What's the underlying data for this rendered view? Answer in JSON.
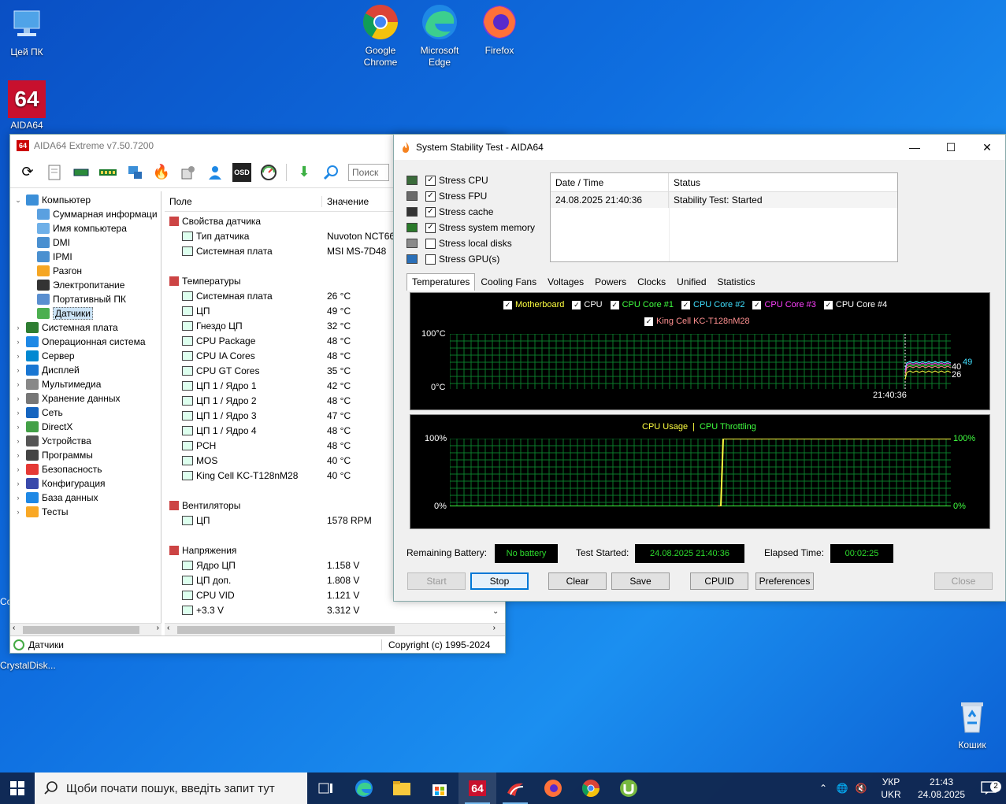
{
  "desktop": {
    "icons": [
      {
        "label": "Цей ПК"
      },
      {
        "label": "Google Chrome"
      },
      {
        "label": "Microsoft Edge"
      },
      {
        "label": "Firefox"
      },
      {
        "label": "AIDA64"
      },
      {
        "label": "CrystalDisk..."
      },
      {
        "label": "Кошик"
      }
    ],
    "partial_label_left": "Co"
  },
  "aida": {
    "title": "AIDA64 Extreme v7.50.7200",
    "app_badge": "64",
    "search_placeholder": "Поиск",
    "osd_label": "OSD",
    "tree": [
      {
        "label": "Компьютер",
        "expanded": true
      },
      {
        "label": "Суммарная информаци",
        "child": true
      },
      {
        "label": "Имя компьютера",
        "child": true
      },
      {
        "label": "DMI",
        "child": true
      },
      {
        "label": "IPMI",
        "child": true
      },
      {
        "label": "Разгон",
        "child": true
      },
      {
        "label": "Электропитание",
        "child": true
      },
      {
        "label": "Портативный ПК",
        "child": true
      },
      {
        "label": "Датчики",
        "child": true,
        "selected": true
      },
      {
        "label": "Системная плата"
      },
      {
        "label": "Операционная система"
      },
      {
        "label": "Сервер"
      },
      {
        "label": "Дисплей"
      },
      {
        "label": "Мультимедиа"
      },
      {
        "label": "Хранение данных"
      },
      {
        "label": "Сеть"
      },
      {
        "label": "DirectX"
      },
      {
        "label": "Устройства"
      },
      {
        "label": "Программы"
      },
      {
        "label": "Безопасность"
      },
      {
        "label": "Конфигурация"
      },
      {
        "label": "База данных"
      },
      {
        "label": "Тесты"
      }
    ],
    "columns": {
      "field": "Поле",
      "value": "Значение"
    },
    "rows": [
      {
        "type": "sec",
        "name": "Свойства датчика",
        "value": ""
      },
      {
        "type": "item",
        "name": "Тип датчика",
        "value": "Nuvoton NCT66"
      },
      {
        "type": "item",
        "name": "Системная плата",
        "value": "MSI MS-7D48"
      },
      {
        "type": "gap"
      },
      {
        "type": "sec",
        "name": "Температуры",
        "value": ""
      },
      {
        "type": "item",
        "name": "Системная плата",
        "value": "26 °C"
      },
      {
        "type": "item",
        "name": "ЦП",
        "value": "49 °C"
      },
      {
        "type": "item",
        "name": "Гнездо ЦП",
        "value": "32 °C"
      },
      {
        "type": "item",
        "name": "CPU Package",
        "value": "48 °C"
      },
      {
        "type": "item",
        "name": "CPU IA Cores",
        "value": "48 °C"
      },
      {
        "type": "item",
        "name": "CPU GT Cores",
        "value": "35 °C"
      },
      {
        "type": "item",
        "name": "ЦП 1 / Ядро 1",
        "value": "42 °C"
      },
      {
        "type": "item",
        "name": "ЦП 1 / Ядро 2",
        "value": "48 °C"
      },
      {
        "type": "item",
        "name": "ЦП 1 / Ядро 3",
        "value": "47 °C"
      },
      {
        "type": "item",
        "name": "ЦП 1 / Ядро 4",
        "value": "48 °C"
      },
      {
        "type": "item",
        "name": "PCH",
        "value": "48 °C"
      },
      {
        "type": "item",
        "name": "MOS",
        "value": "40 °C"
      },
      {
        "type": "item",
        "name": "King Cell KC-T128nM28",
        "value": "40 °C"
      },
      {
        "type": "gap"
      },
      {
        "type": "sec",
        "name": "Вентиляторы",
        "value": ""
      },
      {
        "type": "item",
        "name": "ЦП",
        "value": "1578 RPM"
      },
      {
        "type": "gap"
      },
      {
        "type": "sec",
        "name": "Напряжения",
        "value": ""
      },
      {
        "type": "item",
        "name": "Ядро ЦП",
        "value": "1.158 V"
      },
      {
        "type": "item",
        "name": "ЦП доп.",
        "value": "1.808 V"
      },
      {
        "type": "item",
        "name": "CPU VID",
        "value": "1.121 V"
      },
      {
        "type": "item",
        "name": "+3.3 V",
        "value": "3.312 V"
      }
    ],
    "status_left": "Датчики",
    "status_right": "Copyright (c) 1995-2024"
  },
  "sst": {
    "title": "System Stability Test - AIDA64",
    "stress": [
      {
        "label": "Stress CPU",
        "checked": true
      },
      {
        "label": "Stress FPU",
        "checked": true
      },
      {
        "label": "Stress cache",
        "checked": true
      },
      {
        "label": "Stress system memory",
        "checked": true
      },
      {
        "label": "Stress local disks",
        "checked": false
      },
      {
        "label": "Stress GPU(s)",
        "checked": false
      }
    ],
    "log": {
      "col_date": "Date / Time",
      "col_status": "Status",
      "rows": [
        {
          "date": "24.08.2025 21:40:36",
          "status": "Stability Test: Started"
        }
      ]
    },
    "tabs": [
      "Temperatures",
      "Cooling Fans",
      "Voltages",
      "Powers",
      "Clocks",
      "Unified",
      "Statistics"
    ],
    "temp_graph": {
      "legend": [
        {
          "label": "Motherboard",
          "color": "#ffff40"
        },
        {
          "label": "CPU",
          "color": "#ffffff"
        },
        {
          "label": "CPU Core #1",
          "color": "#40ff40"
        },
        {
          "label": "CPU Core #2",
          "color": "#40e0ff"
        },
        {
          "label": "CPU Core #3",
          "color": "#ff40ff"
        },
        {
          "label": "CPU Core #4",
          "color": "#ffffff"
        },
        {
          "label": "King Cell KC-T128nM28",
          "color": "#ff9090"
        }
      ],
      "y_max": "100°C",
      "y_min": "0°C",
      "x_label": "21:40:36",
      "right_values": [
        "40",
        "26",
        "49"
      ]
    },
    "cpu_graph": {
      "legend_usage": "CPU Usage",
      "legend_sep": "|",
      "legend_throttle": "CPU Throttling",
      "y_max_left": "100%",
      "y_min_left": "0%",
      "y_max_right": "100%",
      "y_min_right": "0%",
      "usage_color": "#ffff40",
      "throttle_color": "#40ff40"
    },
    "info": {
      "battery_label": "Remaining Battery:",
      "battery_value": "No battery",
      "started_label": "Test Started:",
      "started_value": "24.08.2025 21:40:36",
      "elapsed_label": "Elapsed Time:",
      "elapsed_value": "00:02:25"
    },
    "buttons": {
      "start": "Start",
      "stop": "Stop",
      "clear": "Clear",
      "save": "Save",
      "cpuid": "CPUID",
      "preferences": "Preferences",
      "close": "Close"
    }
  },
  "taskbar": {
    "search_placeholder": "Щоби почати пошук, введіть запит тут",
    "lang_top": "УКР",
    "lang_bottom": "UKR",
    "time": "21:43",
    "date": "24.08.2025",
    "notif_count": "2",
    "aida_badge": "64"
  }
}
